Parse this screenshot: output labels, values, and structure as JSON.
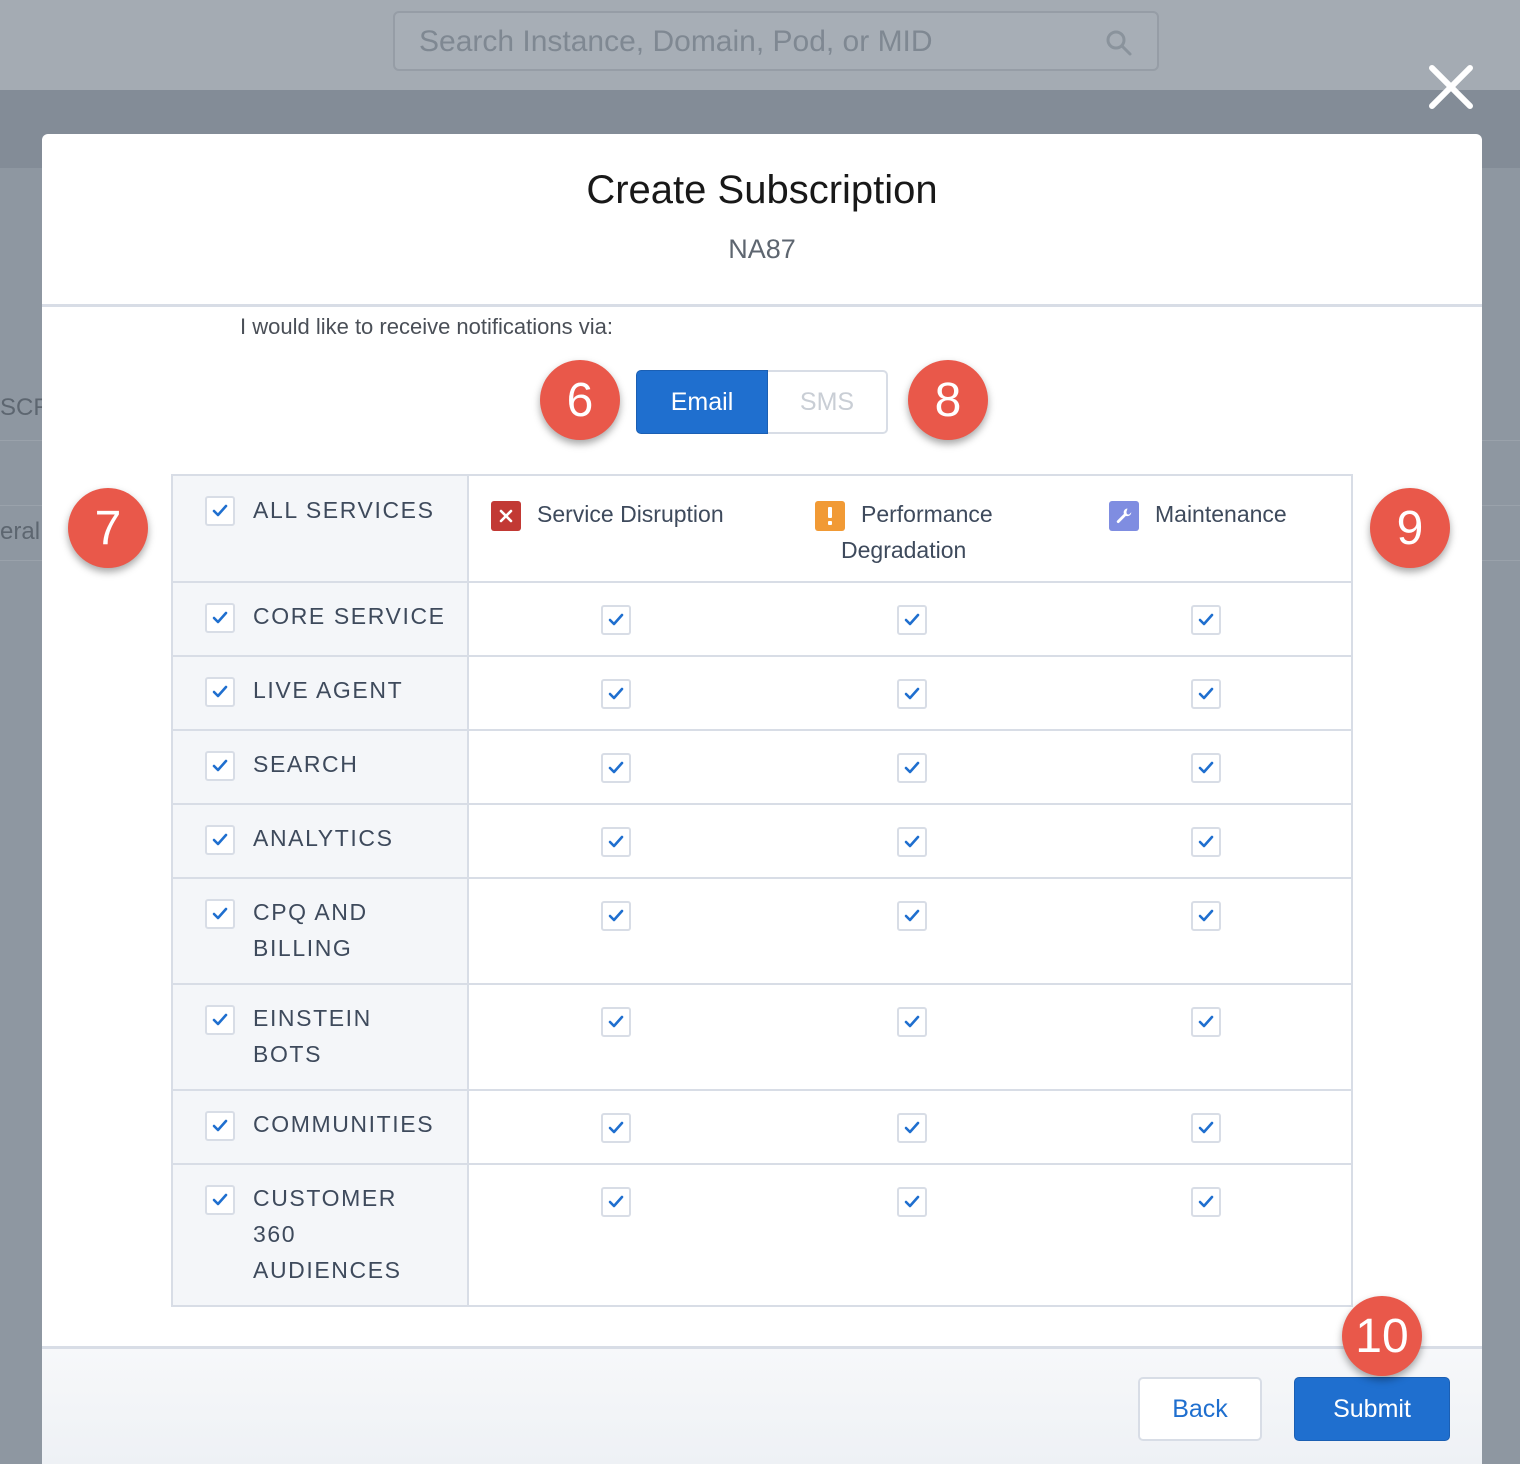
{
  "background": {
    "search_placeholder": "Search Instance, Domain, Pod, or MID",
    "fragment_1": "SCR",
    "fragment_2": "eral"
  },
  "modal": {
    "title": "Create Subscription",
    "subtitle": "NA87",
    "intro": "I would like to receive notifications via:",
    "toggle": {
      "email": "Email",
      "sms": "SMS",
      "selected": "Email"
    },
    "all_services_label": "ALL SERVICES",
    "columns": [
      {
        "label_line1": "Service Disruption",
        "label_line2": "",
        "icon": "x-icon",
        "color": "#c23934"
      },
      {
        "label_line1": "Performance",
        "label_line2": "Degradation",
        "icon": "exclamation-icon",
        "color": "#f19a35"
      },
      {
        "label_line1": "Maintenance",
        "label_line2": "",
        "icon": "wrench-icon",
        "color": "#7f8de1"
      }
    ],
    "services": [
      {
        "line1": "CORE SERVICE",
        "line2": "",
        "line3": ""
      },
      {
        "line1": "LIVE AGENT",
        "line2": "",
        "line3": ""
      },
      {
        "line1": "SEARCH",
        "line2": "",
        "line3": ""
      },
      {
        "line1": "ANALYTICS",
        "line2": "",
        "line3": ""
      },
      {
        "line1": "CPQ AND",
        "line2": "BILLING",
        "line3": ""
      },
      {
        "line1": "EINSTEIN",
        "line2": "BOTS",
        "line3": ""
      },
      {
        "line1": "COMMUNITIES",
        "line2": "",
        "line3": ""
      },
      {
        "line1": "CUSTOMER",
        "line2": "360",
        "line3": "AUDIENCES"
      }
    ],
    "back_label": "Back",
    "submit_label": "Submit"
  },
  "callouts": {
    "c6": "6",
    "c7": "7",
    "c8": "8",
    "c9": "9",
    "c10": "10"
  },
  "colors": {
    "accent": "#1f6fcf",
    "callout": "#e9584a",
    "check": "#1f6fcf"
  }
}
